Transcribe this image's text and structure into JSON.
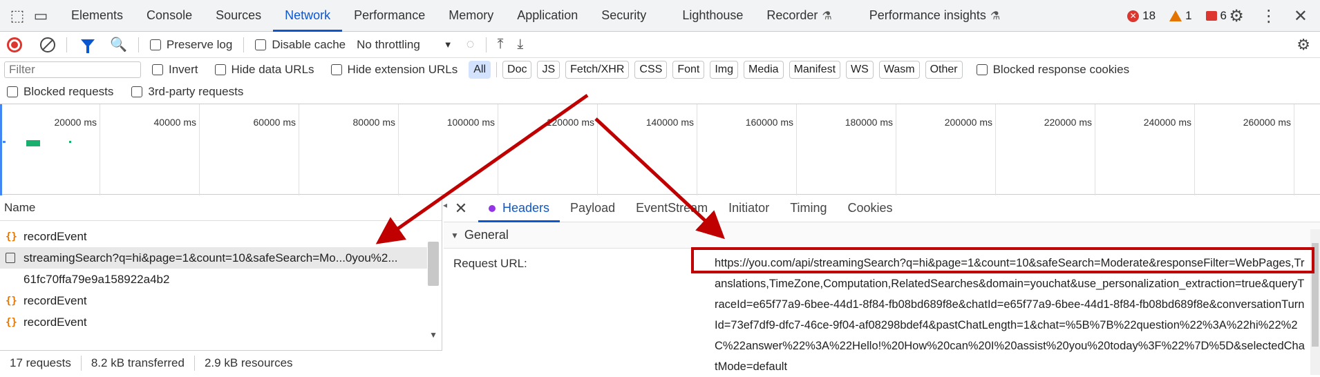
{
  "top_tabs": [
    "Elements",
    "Console",
    "Sources",
    "Network",
    "Performance",
    "Memory",
    "Application",
    "Security",
    "Lighthouse",
    "Recorder",
    "Performance insights"
  ],
  "counts": {
    "errors": "18",
    "warnings": "1",
    "issues": "6"
  },
  "toolbar": {
    "preserve_log": "Preserve log",
    "disable_cache": "Disable cache",
    "throttling": "No throttling"
  },
  "filter": {
    "placeholder": "Filter",
    "invert": "Invert",
    "hide_data_urls": "Hide data URLs",
    "hide_extension_urls": "Hide extension URLs",
    "chips": [
      "All",
      "Doc",
      "JS",
      "Fetch/XHR",
      "CSS",
      "Font",
      "Img",
      "Media",
      "Manifest",
      "WS",
      "Wasm",
      "Other"
    ],
    "blocked_response_cookies": "Blocked response cookies",
    "blocked_requests": "Blocked requests",
    "third_party": "3rd-party requests"
  },
  "overview_ticks": [
    "20000 ms",
    "40000 ms",
    "60000 ms",
    "80000 ms",
    "100000 ms",
    "120000 ms",
    "140000 ms",
    "160000 ms",
    "180000 ms",
    "200000 ms",
    "220000 ms",
    "240000 ms",
    "260000 ms"
  ],
  "requests": {
    "header": "Name",
    "rows": [
      "recordEvent",
      "streamingSearch?q=hi&page=1&count=10&safeSearch=Mo...0you%2...",
      "61fc70ffa79e9a158922a4b2",
      "recordEvent",
      "recordEvent"
    ]
  },
  "status": {
    "requests": "17 requests",
    "transferred": "8.2 kB transferred",
    "resources": "2.9 kB resources"
  },
  "detail_tabs": [
    "Headers",
    "Payload",
    "EventStream",
    "Initiator",
    "Timing",
    "Cookies"
  ],
  "general": {
    "section": "General",
    "request_url_label": "Request URL:",
    "request_url": "https://you.com/api/streamingSearch?q=hi&page=1&count=10&safeSearch=Moderate&responseFilter=WebPages,Translations,TimeZone,Computation,RelatedSearches&domain=youchat&use_personalization_extraction=true&queryTraceId=e65f77a9-6bee-44d1-8f84-fb08bd689f8e&chatId=e65f77a9-6bee-44d1-8f84-fb08bd689f8e&conversationTurnId=73ef7df9-dfc7-46ce-9f04-af08298bdef4&pastChatLength=1&chat=%5B%7B%22question%22%3A%22hi%22%2C%22answer%22%3A%22Hello!%20How%20can%20I%20assist%20you%20today%3F%22%7D%5D&selectedChatMode=default"
  },
  "colors": {
    "accent": "#0b57d0",
    "annotation": "#c00000",
    "error": "#dc362e",
    "warning": "#e37400"
  }
}
